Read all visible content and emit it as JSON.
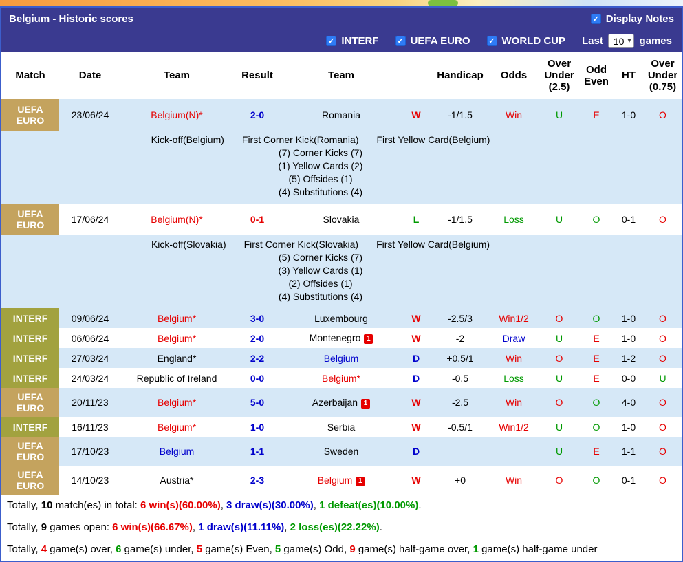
{
  "colors": {
    "header_purple": "#3a3a90",
    "row_light_blue": "#d6e8f7",
    "uefa_euro_gold": "#c4a35e",
    "interf_olive": "#a2a23f",
    "win_red": "#e60000",
    "draw_blue": "#0000cc",
    "loss_green": "#009900",
    "frame_border_blue": "#3c5ecc"
  },
  "icons": {
    "check": "✓",
    "dropdown_arrow": "▾"
  },
  "header": {
    "title": "Belgium - Historic scores",
    "display_notes": "Display Notes"
  },
  "filter_bar": {
    "checkboxes": [
      {
        "label": "INTERF",
        "checked": true
      },
      {
        "label": "UEFA EURO",
        "checked": true
      },
      {
        "label": "WORLD CUP",
        "checked": true
      }
    ],
    "last_label": "Last",
    "games_count": "10",
    "games_label": "games"
  },
  "table": {
    "headers": {
      "match": "Match",
      "date": "Date",
      "team1": "Team",
      "result": "Result",
      "team2": "Team",
      "handicap": "Handicap",
      "odds": "Odds",
      "ou25": "Over Under (2.5)",
      "oddeven": "Odd Even",
      "ht": "HT",
      "ou075": "Over Under (0.75)"
    },
    "rows": [
      {
        "comp": "UEFA EURO",
        "date": "23/06/24",
        "t1": {
          "t": "Belgium(N)*",
          "c": "red"
        },
        "res": {
          "t": "2-0",
          "c": "blue"
        },
        "t2": {
          "t": "Romania",
          "c": "black"
        },
        "wdl": {
          "t": "W",
          "c": "red"
        },
        "hcp": "-1/1.5",
        "odds": {
          "t": "Win",
          "c": "red"
        },
        "ou": {
          "t": "U",
          "c": "green"
        },
        "oe": {
          "t": "E",
          "c": "red"
        },
        "ht": "1-0",
        "ou75": {
          "t": "O",
          "c": "red"
        },
        "notes": {
          "kicks": [
            "Kick-off(Belgium)",
            "First Corner Kick(Romania)",
            "First Yellow Card(Belgium)"
          ],
          "stats": [
            "(7) Corner Kicks (7)",
            "(1) Yellow Cards (2)",
            "(5) Offsides (1)",
            "(4) Substitutions (4)"
          ]
        }
      },
      {
        "comp": "UEFA EURO",
        "date": "17/06/24",
        "t1": {
          "t": "Belgium(N)*",
          "c": "red"
        },
        "res": {
          "t": "0-1",
          "c": "red"
        },
        "t2": {
          "t": "Slovakia",
          "c": "black"
        },
        "wdl": {
          "t": "L",
          "c": "green"
        },
        "hcp": "-1/1.5",
        "odds": {
          "t": "Loss",
          "c": "green"
        },
        "ou": {
          "t": "U",
          "c": "green"
        },
        "oe": {
          "t": "O",
          "c": "green"
        },
        "ht": "0-1",
        "ou75": {
          "t": "O",
          "c": "red"
        },
        "notes": {
          "kicks": [
            "Kick-off(Slovakia)",
            "First Corner Kick(Slovakia)",
            "First Yellow Card(Belgium)"
          ],
          "stats": [
            "(5) Corner Kicks (7)",
            "(3) Yellow Cards (1)",
            "(2) Offsides (1)",
            "(4) Substitutions (4)"
          ]
        }
      },
      {
        "comp": "INTERF",
        "date": "09/06/24",
        "t1": {
          "t": "Belgium*",
          "c": "red"
        },
        "res": {
          "t": "3-0",
          "c": "blue"
        },
        "t2": {
          "t": "Luxembourg",
          "c": "black"
        },
        "wdl": {
          "t": "W",
          "c": "red"
        },
        "hcp": "-2.5/3",
        "odds": {
          "t": "Win1/2",
          "c": "red"
        },
        "ou": {
          "t": "O",
          "c": "red"
        },
        "oe": {
          "t": "O",
          "c": "green"
        },
        "ht": "1-0",
        "ou75": {
          "t": "O",
          "c": "red"
        }
      },
      {
        "comp": "INTERF",
        "date": "06/06/24",
        "t1": {
          "t": "Belgium*",
          "c": "red"
        },
        "res": {
          "t": "2-0",
          "c": "blue"
        },
        "t2": {
          "t": "Montenegro",
          "c": "black",
          "badge": "1"
        },
        "wdl": {
          "t": "W",
          "c": "red"
        },
        "hcp": "-2",
        "odds": {
          "t": "Draw",
          "c": "blue"
        },
        "ou": {
          "t": "U",
          "c": "green"
        },
        "oe": {
          "t": "E",
          "c": "red"
        },
        "ht": "1-0",
        "ou75": {
          "t": "O",
          "c": "red"
        }
      },
      {
        "comp": "INTERF",
        "date": "27/03/24",
        "t1": {
          "t": "England*",
          "c": "black"
        },
        "res": {
          "t": "2-2",
          "c": "blue"
        },
        "t2": {
          "t": "Belgium",
          "c": "blue"
        },
        "wdl": {
          "t": "D",
          "c": "blue"
        },
        "hcp": "+0.5/1",
        "odds": {
          "t": "Win",
          "c": "red"
        },
        "ou": {
          "t": "O",
          "c": "red"
        },
        "oe": {
          "t": "E",
          "c": "red"
        },
        "ht": "1-2",
        "ou75": {
          "t": "O",
          "c": "red"
        }
      },
      {
        "comp": "INTERF",
        "date": "24/03/24",
        "t1": {
          "t": "Republic of Ireland",
          "c": "black"
        },
        "res": {
          "t": "0-0",
          "c": "blue"
        },
        "t2": {
          "t": "Belgium*",
          "c": "red"
        },
        "wdl": {
          "t": "D",
          "c": "blue"
        },
        "hcp": "-0.5",
        "odds": {
          "t": "Loss",
          "c": "green"
        },
        "ou": {
          "t": "U",
          "c": "green"
        },
        "oe": {
          "t": "E",
          "c": "red"
        },
        "ht": "0-0",
        "ou75": {
          "t": "U",
          "c": "green"
        }
      },
      {
        "comp": "UEFA EURO",
        "date": "20/11/23",
        "t1": {
          "t": "Belgium*",
          "c": "red"
        },
        "res": {
          "t": "5-0",
          "c": "blue"
        },
        "t2": {
          "t": "Azerbaijan",
          "c": "black",
          "badge": "1"
        },
        "wdl": {
          "t": "W",
          "c": "red"
        },
        "hcp": "-2.5",
        "odds": {
          "t": "Win",
          "c": "red"
        },
        "ou": {
          "t": "O",
          "c": "red"
        },
        "oe": {
          "t": "O",
          "c": "green"
        },
        "ht": "4-0",
        "ou75": {
          "t": "O",
          "c": "red"
        }
      },
      {
        "comp": "INTERF",
        "date": "16/11/23",
        "t1": {
          "t": "Belgium*",
          "c": "red"
        },
        "res": {
          "t": "1-0",
          "c": "blue"
        },
        "t2": {
          "t": "Serbia",
          "c": "black"
        },
        "wdl": {
          "t": "W",
          "c": "red"
        },
        "hcp": "-0.5/1",
        "odds": {
          "t": "Win1/2",
          "c": "red"
        },
        "ou": {
          "t": "U",
          "c": "green"
        },
        "oe": {
          "t": "O",
          "c": "green"
        },
        "ht": "1-0",
        "ou75": {
          "t": "O",
          "c": "red"
        }
      },
      {
        "comp": "UEFA EURO",
        "date": "17/10/23",
        "t1": {
          "t": "Belgium",
          "c": "blue"
        },
        "res": {
          "t": "1-1",
          "c": "blue"
        },
        "t2": {
          "t": "Sweden",
          "c": "black"
        },
        "wdl": {
          "t": "D",
          "c": "blue"
        },
        "hcp": "",
        "odds": {
          "t": "",
          "c": ""
        },
        "ou": {
          "t": "U",
          "c": "green"
        },
        "oe": {
          "t": "E",
          "c": "red"
        },
        "ht": "1-1",
        "ou75": {
          "t": "O",
          "c": "red"
        }
      },
      {
        "comp": "UEFA EURO",
        "date": "14/10/23",
        "t1": {
          "t": "Austria*",
          "c": "black"
        },
        "res": {
          "t": "2-3",
          "c": "blue"
        },
        "t2": {
          "t": "Belgium",
          "c": "red",
          "badge": "1"
        },
        "wdl": {
          "t": "W",
          "c": "red"
        },
        "hcp": "+0",
        "odds": {
          "t": "Win",
          "c": "red"
        },
        "ou": {
          "t": "O",
          "c": "red"
        },
        "oe": {
          "t": "O",
          "c": "green"
        },
        "ht": "0-1",
        "ou75": {
          "t": "O",
          "c": "red"
        }
      }
    ]
  },
  "footer": {
    "lines": [
      {
        "segments": [
          {
            "t": "Totally, "
          },
          {
            "t": "10",
            "c": "num"
          },
          {
            "t": " match(es) in total: "
          },
          {
            "t": "6 win(s)(60.00%)",
            "c": "red"
          },
          {
            "t": ", "
          },
          {
            "t": "3 draw(s)(30.00%)",
            "c": "blue"
          },
          {
            "t": ", "
          },
          {
            "t": "1 defeat(es)(10.00%)",
            "c": "green"
          },
          {
            "t": "."
          }
        ]
      },
      {
        "segments": [
          {
            "t": "Totally, "
          },
          {
            "t": "9",
            "c": "num"
          },
          {
            "t": " games open: "
          },
          {
            "t": "6 win(s)(66.67%)",
            "c": "red"
          },
          {
            "t": ", "
          },
          {
            "t": "1 draw(s)(11.11%)",
            "c": "blue"
          },
          {
            "t": ", "
          },
          {
            "t": "2 loss(es)(22.22%)",
            "c": "green"
          },
          {
            "t": "."
          }
        ]
      },
      {
        "segments": [
          {
            "t": "Totally, "
          },
          {
            "t": "4",
            "c": "red"
          },
          {
            "t": " game(s) over, "
          },
          {
            "t": "6",
            "c": "green"
          },
          {
            "t": " game(s) under, "
          },
          {
            "t": "5",
            "c": "red"
          },
          {
            "t": " game(s) Even, "
          },
          {
            "t": "5",
            "c": "green"
          },
          {
            "t": " game(s) Odd, "
          },
          {
            "t": "9",
            "c": "red"
          },
          {
            "t": " game(s) half-game over, "
          },
          {
            "t": "1",
            "c": "green"
          },
          {
            "t": " game(s) half-game under"
          }
        ]
      }
    ]
  }
}
